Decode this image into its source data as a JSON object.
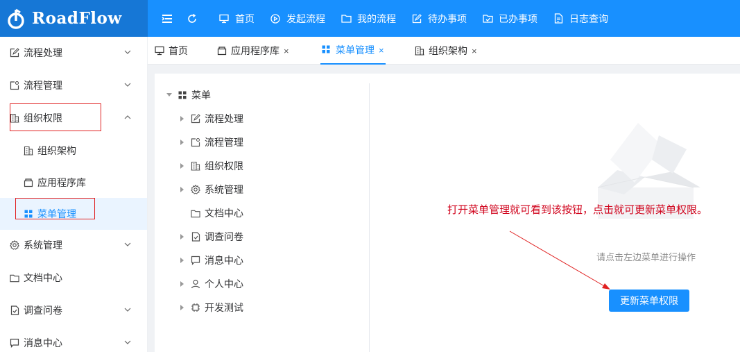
{
  "app": {
    "logo_text": "RoadFlow"
  },
  "topnav": {
    "items": [
      {
        "label": "首页",
        "icon": "monitor-icon"
      },
      {
        "label": "发起流程",
        "icon": "play-circle-icon"
      },
      {
        "label": "我的流程",
        "icon": "folder-icon"
      },
      {
        "label": "待办事项",
        "icon": "edit-icon"
      },
      {
        "label": "已办事项",
        "icon": "check-folder-icon"
      },
      {
        "label": "日志查询",
        "icon": "document-icon"
      }
    ]
  },
  "sidebar": {
    "items": [
      {
        "label": "流程处理",
        "icon": "edit-icon",
        "expandable": true
      },
      {
        "label": "流程管理",
        "icon": "flow-manage-icon",
        "expandable": true
      },
      {
        "label": "组织权限",
        "icon": "building-icon",
        "expandable": true,
        "expanded": true
      },
      {
        "label": "组织架构",
        "icon": "building-icon",
        "sub": true
      },
      {
        "label": "应用程序库",
        "icon": "box-icon",
        "sub": true
      },
      {
        "label": "菜单管理",
        "icon": "grid-icon",
        "sub": true,
        "active": true
      },
      {
        "label": "系统管理",
        "icon": "gear-icon",
        "expandable": true
      },
      {
        "label": "文档中心",
        "icon": "folder-icon",
        "expandable": false
      },
      {
        "label": "调查问卷",
        "icon": "survey-icon",
        "expandable": true
      },
      {
        "label": "消息中心",
        "icon": "message-icon",
        "expandable": true
      }
    ]
  },
  "tabs": [
    {
      "label": "首页",
      "icon": "monitor-icon",
      "closable": false
    },
    {
      "label": "应用程序库",
      "icon": "box-icon",
      "closable": true
    },
    {
      "label": "菜单管理",
      "icon": "grid-icon",
      "closable": true,
      "active": true
    },
    {
      "label": "组织架构",
      "icon": "building-icon",
      "closable": true
    }
  ],
  "tabs_close_glyph": "×",
  "tree": {
    "root": {
      "label": "菜单",
      "icon": "grid-icon"
    },
    "children": [
      {
        "label": "流程处理",
        "icon": "edit-icon",
        "has_children": true
      },
      {
        "label": "流程管理",
        "icon": "flow-manage-icon",
        "has_children": true
      },
      {
        "label": "组织权限",
        "icon": "building-icon",
        "has_children": true
      },
      {
        "label": "系统管理",
        "icon": "gear-icon",
        "has_children": true
      },
      {
        "label": "文档中心",
        "icon": "folder-icon",
        "has_children": false
      },
      {
        "label": "调查问卷",
        "icon": "survey-icon",
        "has_children": true
      },
      {
        "label": "消息中心",
        "icon": "message-icon",
        "has_children": true
      },
      {
        "label": "个人中心",
        "icon": "user-icon",
        "has_children": true
      },
      {
        "label": "开发测试",
        "icon": "chip-icon",
        "has_children": true
      }
    ]
  },
  "main": {
    "annotation": "打开菜单管理就可看到该按钮，点击就可更新菜单权限。",
    "hint": "请点击左边菜单进行操作",
    "button_label": "更新菜单权限"
  },
  "colors": {
    "primary": "#1890ff",
    "annotation": "#d0021b",
    "highlight_box": "#e02020"
  }
}
